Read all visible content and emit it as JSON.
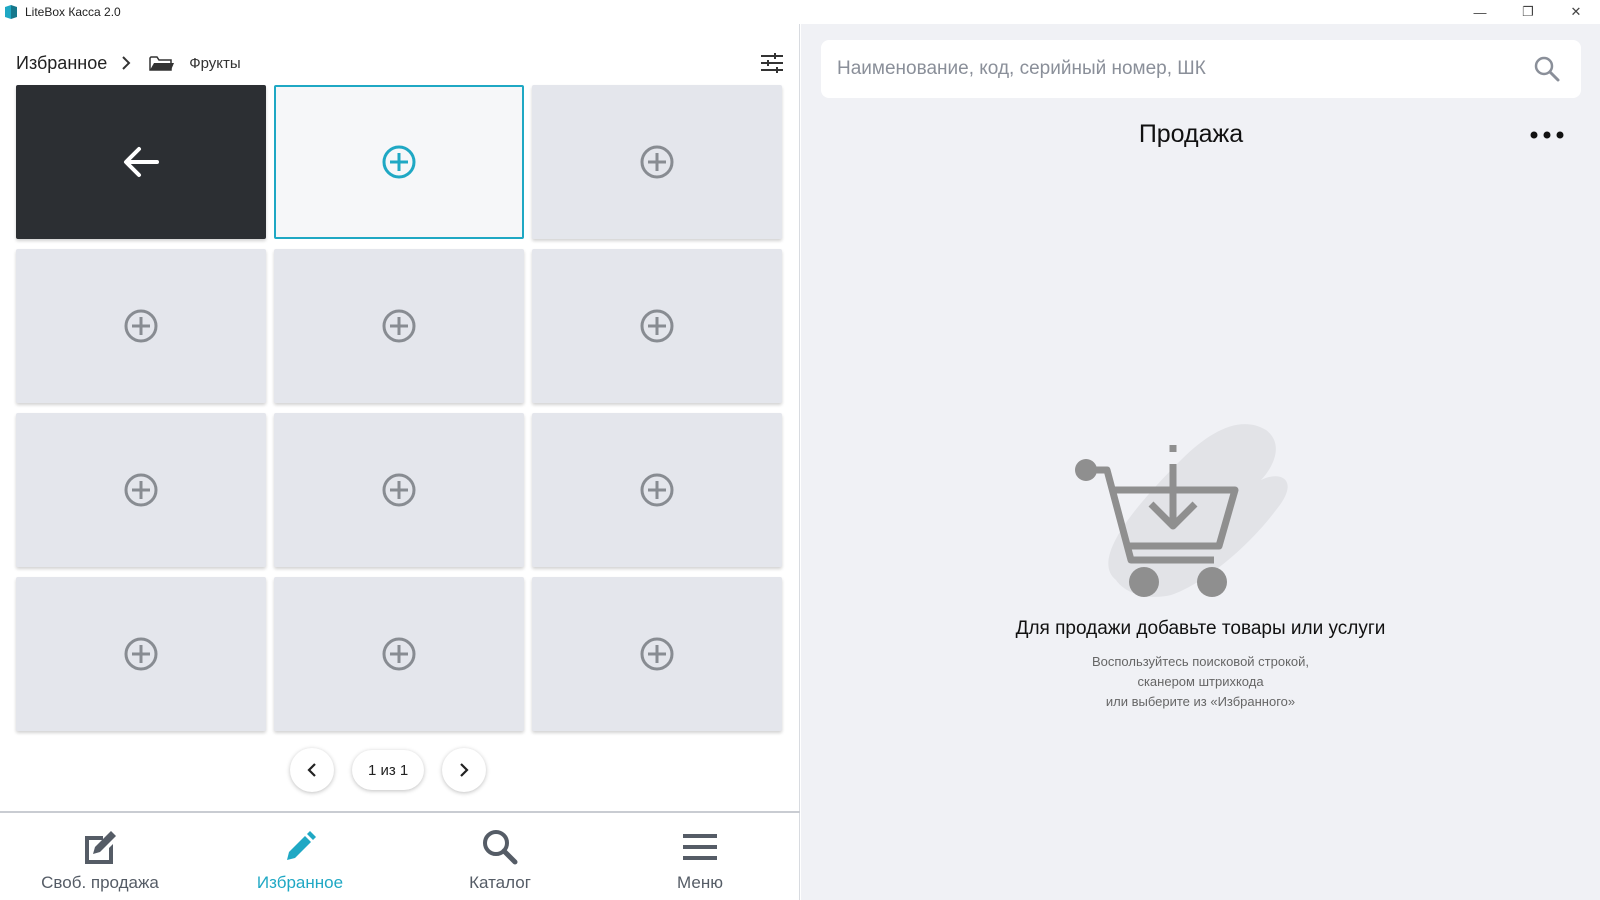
{
  "window": {
    "title": "LiteBox Касса 2.0",
    "controls": {
      "minimize": "—",
      "restore": "❐",
      "close": "✕"
    }
  },
  "breadcrumb": {
    "root": "Избранное",
    "folder": "Фрукты"
  },
  "tiles": {
    "back_icon": "arrow-left-icon",
    "add_icon": "plus-circle-icon"
  },
  "pager": {
    "label": "1 из 1"
  },
  "bottom_nav": {
    "items": [
      {
        "label": "Своб. продажа",
        "icon": "edit-receipt-icon",
        "active": false
      },
      {
        "label": "Избранное",
        "icon": "pencil-icon",
        "active": true
      },
      {
        "label": "Каталог",
        "icon": "search-icon",
        "active": false
      },
      {
        "label": "Меню",
        "icon": "hamburger-icon",
        "active": false
      }
    ]
  },
  "search": {
    "placeholder": "Наименование, код, серийный номер, ШК",
    "value": ""
  },
  "sale": {
    "title": "Продажа"
  },
  "empty_state": {
    "title": "Для продажи добавьте товары или услуги",
    "line1": "Воспользуйтесь поисковой строкой,",
    "line2": "сканером штрихкода",
    "line3": "или выберите из «Избранного»"
  },
  "colors": {
    "accent": "#1fa8c4",
    "tile": "#e4e6ec",
    "back_tile": "#2c2f33",
    "panel_bg": "#f0f1f5"
  }
}
